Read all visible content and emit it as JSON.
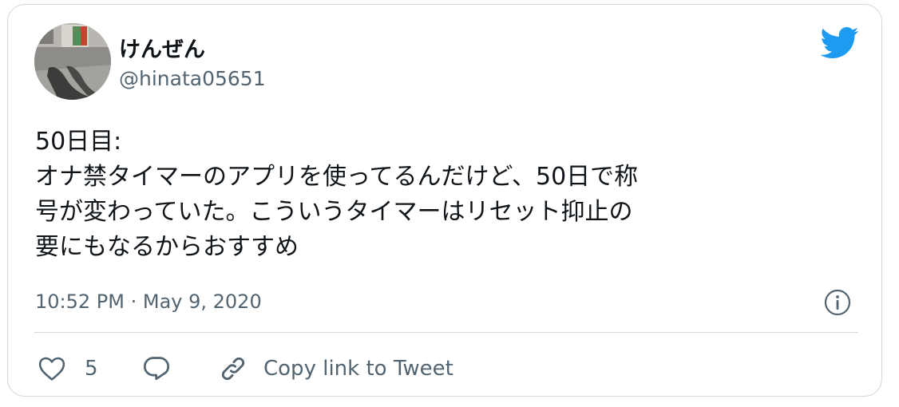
{
  "user": {
    "display_name": "けんぜん",
    "handle": "@hinata05651",
    "avatar_icon": "profile-photo-shadow-street"
  },
  "brand": {
    "icon": "twitter-bird-icon",
    "color": "#1d9bf0"
  },
  "tweet": {
    "lines": [
      "50日目:",
      "オナ禁タイマーのアプリを使ってるんだけど、50日で称",
      "号が変わっていた。こういうタイマーはリセット抑止の",
      "要にもなるからおすすめ"
    ],
    "timestamp": "10:52 PM · May 9, 2020"
  },
  "actions": {
    "like_icon": "heart-icon",
    "like_count": "5",
    "reply_icon": "reply-bubble-icon",
    "copy_icon": "link-icon",
    "copy_label": "Copy link to Tweet",
    "info_icon": "info-icon"
  },
  "colors": {
    "text_primary": "#0f1419",
    "text_secondary": "#536471",
    "border": "#cfd9de"
  }
}
